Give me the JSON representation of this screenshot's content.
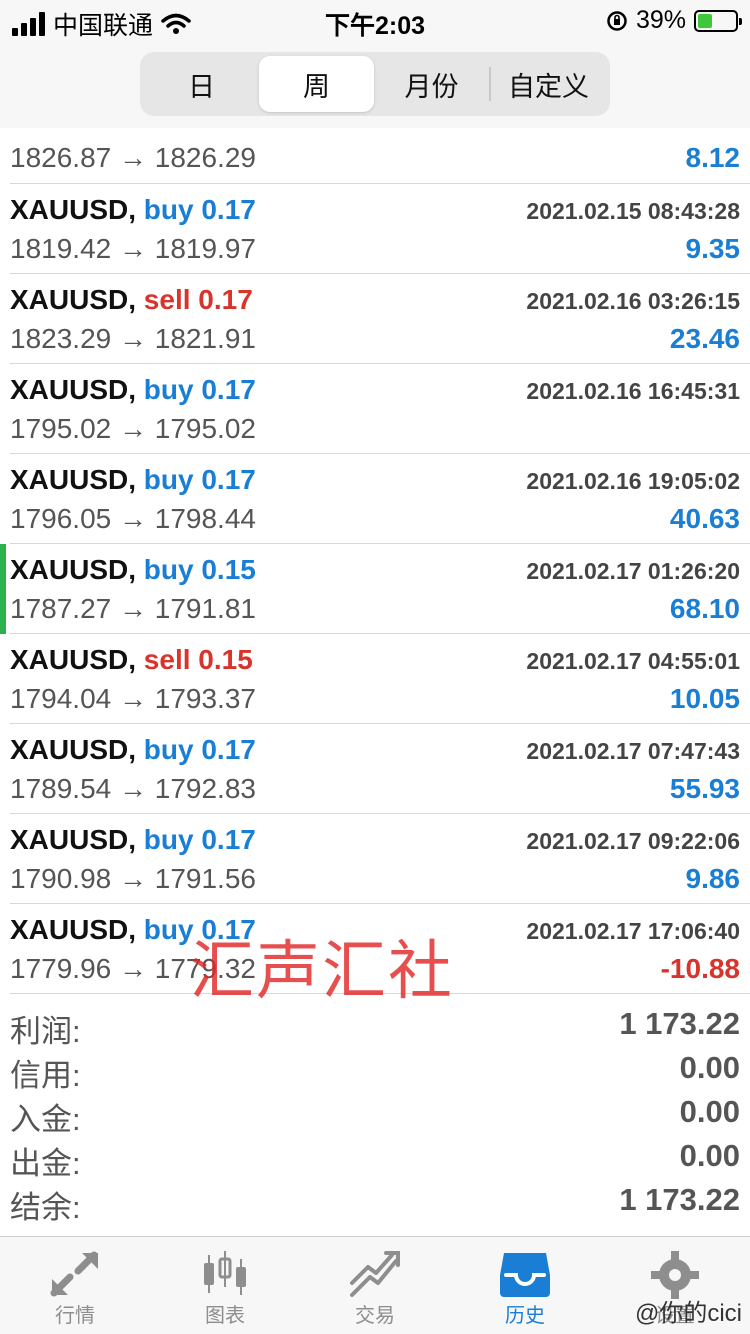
{
  "status": {
    "carrier": "中国联通",
    "time": "下午2:03",
    "battery": "39%",
    "battery_level": 0.39
  },
  "segments": [
    {
      "label": "日",
      "active": false
    },
    {
      "label": "周",
      "active": true
    },
    {
      "label": "月份",
      "active": false
    },
    {
      "label": "自定义",
      "active": false
    }
  ],
  "partial_deal": {
    "prices": "1826.87 → 1826.29",
    "profit": "8.12"
  },
  "deals": [
    {
      "symbol": "XAUUSD,",
      "side": "buy",
      "volume": "0.17",
      "time": "2021.02.15 08:43:28",
      "prices": "1819.42 → 1819.97",
      "profit": "9.35"
    },
    {
      "symbol": "XAUUSD,",
      "side": "sell",
      "volume": "0.17",
      "time": "2021.02.16 03:26:15",
      "prices": "1823.29 → 1821.91",
      "profit": "23.46"
    },
    {
      "symbol": "XAUUSD,",
      "side": "buy",
      "volume": "0.17",
      "time": "2021.02.16 16:45:31",
      "prices": "1795.02 → 1795.02",
      "profit": ""
    },
    {
      "symbol": "XAUUSD,",
      "side": "buy",
      "volume": "0.17",
      "time": "2021.02.16 19:05:02",
      "prices": "1796.05 → 1798.44",
      "profit": "40.63"
    },
    {
      "symbol": "XAUUSD,",
      "side": "buy",
      "volume": "0.15",
      "time": "2021.02.17 01:26:20",
      "prices": "1787.27 → 1791.81",
      "profit": "68.10"
    },
    {
      "symbol": "XAUUSD,",
      "side": "sell",
      "volume": "0.15",
      "time": "2021.02.17 04:55:01",
      "prices": "1794.04 → 1793.37",
      "profit": "10.05"
    },
    {
      "symbol": "XAUUSD,",
      "side": "buy",
      "volume": "0.17",
      "time": "2021.02.17 07:47:43",
      "prices": "1789.54 → 1792.83",
      "profit": "55.93"
    },
    {
      "symbol": "XAUUSD,",
      "side": "buy",
      "volume": "0.17",
      "time": "2021.02.17 09:22:06",
      "prices": "1790.98 → 1791.56",
      "profit": "9.86"
    },
    {
      "symbol": "XAUUSD,",
      "side": "buy",
      "volume": "0.17",
      "time": "2021.02.17 17:06:40",
      "prices": "1779.96 → 1779.32",
      "profit": "-10.88"
    }
  ],
  "summary": [
    {
      "label": "利润:",
      "value": "1 173.22"
    },
    {
      "label": "信用:",
      "value": "0.00"
    },
    {
      "label": "入金:",
      "value": "0.00"
    },
    {
      "label": "出金:",
      "value": "0.00"
    },
    {
      "label": "结余:",
      "value": "1 173.22"
    }
  ],
  "watermark": "汇声汇社",
  "corner_watermark": "@你的cici",
  "tabs": [
    {
      "label": "行情",
      "icon": "quotes-icon",
      "active": false
    },
    {
      "label": "图表",
      "icon": "chart-icon",
      "active": false
    },
    {
      "label": "交易",
      "icon": "trade-icon",
      "active": false
    },
    {
      "label": "历史",
      "icon": "history-icon",
      "active": true
    },
    {
      "label": "设置",
      "icon": "settings-icon",
      "active": false
    }
  ],
  "colors": {
    "buy": "#1a7fd4",
    "sell": "#d8342c",
    "accent": "#1a7fd4",
    "marker": "#2bb24c"
  }
}
